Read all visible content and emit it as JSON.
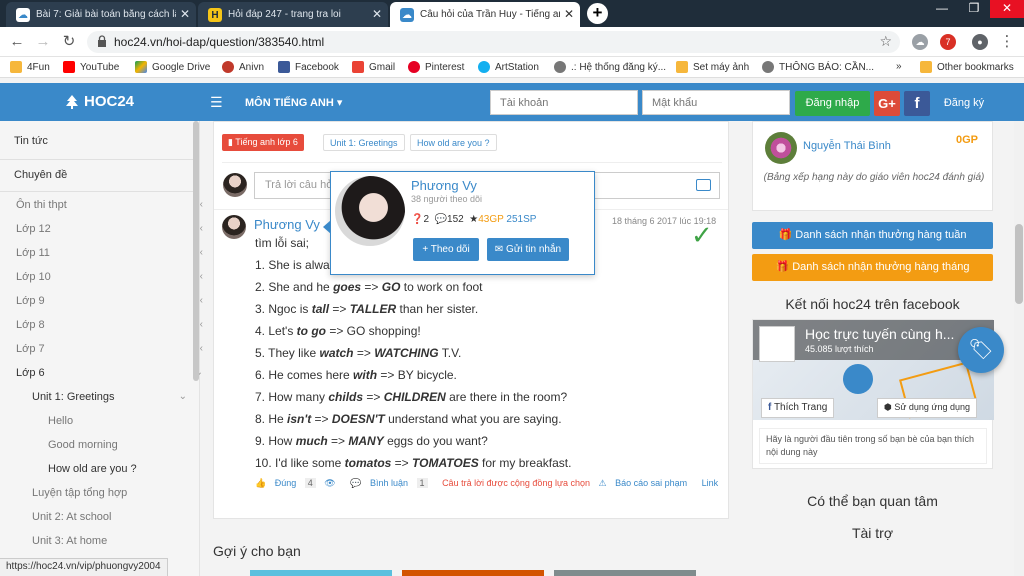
{
  "browser": {
    "tabs": [
      {
        "title": "Bài 7: Giải bài toán bằng cách lập",
        "favicon": "hoc24-icon",
        "active": false
      },
      {
        "title": "Hỏi đáp 247 - trang tra loi",
        "favicon": "h-icon",
        "active": false
      },
      {
        "title": "Câu hỏi của Trần Huy - Tiếng anh",
        "favicon": "hoc24-icon",
        "active": true
      }
    ],
    "url": "hoc24.vn/hoi-dap/question/383540.html",
    "extension_badge": "7",
    "bookmarks": [
      "4Fun",
      "YouTube",
      "Google Drive",
      "Anivn",
      "Facebook",
      "Gmail",
      "Pinterest",
      "ArtStation",
      ".: Hệ thống đăng ký...",
      "Set máy ảnh",
      "THÔNG BÁO: CẦN...",
      "»",
      "Other bookmarks"
    ]
  },
  "header": {
    "logo": "HOC24",
    "subject": "MÔN TIẾNG ANH",
    "username_placeholder": "Tài khoản",
    "password_placeholder": "Mật khẩu",
    "login_label": "Đăng nhập",
    "google_label": "G+",
    "facebook_label": "f",
    "register_label": "Đăng ký"
  },
  "sidebar": {
    "items": [
      {
        "label": "Tin tức",
        "level": 0,
        "chevron": ""
      },
      {
        "label": "Chuyên đề",
        "level": 0,
        "chevron": "⌄"
      },
      {
        "label": "Ôn thi thpt",
        "level": 0,
        "chevron": "‹"
      },
      {
        "label": "Lớp 12",
        "level": 0,
        "chevron": "‹"
      },
      {
        "label": "Lớp 11",
        "level": 0,
        "chevron": "‹"
      },
      {
        "label": "Lớp 10",
        "level": 0,
        "chevron": "‹"
      },
      {
        "label": "Lớp 9",
        "level": 0,
        "chevron": "‹"
      },
      {
        "label": "Lớp 8",
        "level": 0,
        "chevron": "‹"
      },
      {
        "label": "Lớp 7",
        "level": 0,
        "chevron": "‹"
      },
      {
        "label": "Lớp 6",
        "level": 0,
        "chevron": "⌄"
      },
      {
        "label": "Unit 1: Greetings",
        "level": 1,
        "chevron": "⌄"
      },
      {
        "label": "Hello",
        "level": 2,
        "chevron": ""
      },
      {
        "label": "Good morning",
        "level": 2,
        "chevron": ""
      },
      {
        "label": "How old are you ?",
        "level": 2,
        "chevron": ""
      },
      {
        "label": "Luyện tập tổng hợp",
        "level": 1,
        "chevron": ""
      },
      {
        "label": "Unit 2: At school",
        "level": 1,
        "chevron": ""
      },
      {
        "label": "Unit 3: At home",
        "level": 1,
        "chevron": ""
      }
    ]
  },
  "question": {
    "tags": [
      "Tiếng anh lớp 6",
      "Unit 1: Greetings",
      "How old are you ?"
    ],
    "answer_placeholder": "Trả lời câu hỏi"
  },
  "answer": {
    "author": "Phương Vy",
    "time": "18 tháng 6 2017 lúc 19:18",
    "intro": "tìm lỗi sai;",
    "lines": [
      {
        "pre": "1. She is alway",
        "wrong": "",
        "fix": "",
        "post": ""
      },
      {
        "pre": "2. She and he ",
        "wrong": "goes",
        "fix": "GO",
        "post": " to work on foot"
      },
      {
        "pre": "3. Ngoc is ",
        "wrong": "tall",
        "fix": "TALLER",
        "post": " than her sister."
      },
      {
        "pre": "4. Let's ",
        "wrong": "to go",
        "fix": "GO",
        "post": " shopping!"
      },
      {
        "pre": "5. They like ",
        "wrong": "watch",
        "fix": "WATCHING",
        "post": " T.V."
      },
      {
        "pre": "6. He comes here ",
        "wrong": "with",
        "fix": "BY",
        "post": " bicycle."
      },
      {
        "pre": "7. How many ",
        "wrong": "childs",
        "fix": "CHILDREN",
        "post": " are there in the room?"
      },
      {
        "pre": "8. He ",
        "wrong": "isn't",
        "fix": "DOESN'T",
        "post": " understand what you are saying."
      },
      {
        "pre": "9. How ",
        "wrong": "much",
        "fix": "MANY",
        "post": " eggs do you want?"
      },
      {
        "pre": "10. I'd like some ",
        "wrong": "tomatos",
        "fix": "TOMATOES",
        "post": " for my breakfast."
      }
    ],
    "actions": {
      "like": "Đúng",
      "like_count": "4",
      "comment": "Bình luận",
      "comment_count": "1",
      "selected_note": "Câu trả lời được cộng đồng lựa chọn",
      "report": "Báo cáo sai phạm",
      "link": "Link"
    }
  },
  "popover": {
    "name": "Phương Vy",
    "followers": "38 người theo dõi",
    "questions": "2",
    "answers": "152",
    "gp": "43GP",
    "sp": "251SP",
    "follow_label": "Theo dõi",
    "message_label": "Gửi tin nhắn"
  },
  "right": {
    "rank_name": "Nguyễn Thái Bình",
    "rank_points": "0GP",
    "rank_note": "(Bảng xếp hạng này do giáo viên hoc24 đánh giá)",
    "weekly_label": "Danh sách nhận thưởng hàng tuần",
    "monthly_label": "Danh sách nhận thưởng hàng tháng",
    "fb_heading": "Kết nối hoc24 trên facebook",
    "fb_page": "Học trực tuyến cùng h...",
    "fb_likes": "45.085 lượt thích",
    "fb_like_btn": "Thích Trang",
    "fb_use_btn": "Sử dụng ứng dụng",
    "fb_note": "Hãy là người đầu tiên trong số bạn bè của bạn thích nội dung này",
    "maybe_heading": "Có thể bạn quan tâm",
    "sponsor_heading": "Tài trợ"
  },
  "suggest_heading": "Gợi ý cho bạn",
  "status_url": "https://hoc24.vn/vip/phuongvy2004",
  "colors": {
    "brand": "#3a89c9",
    "login": "#2eaa4a",
    "weekly": "#3a89c9",
    "monthly": "#f39c12",
    "highlight": "#e74c3c"
  }
}
